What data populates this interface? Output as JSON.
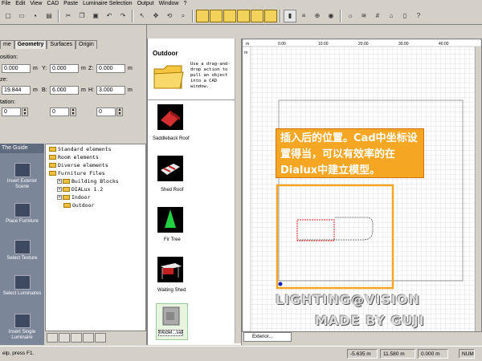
{
  "menu": [
    "File",
    "Edit",
    "View",
    "CAD",
    "Paste",
    "Luminaire Selection",
    "Output",
    "Window",
    "?"
  ],
  "left": {
    "tabs": [
      "me",
      "Geometry",
      "Surfaces",
      "Origin"
    ],
    "position_label": "osition:",
    "size_label": "ze:",
    "rotation_label": "tation:",
    "x_value": "0.000",
    "y_value": "0.000",
    "z_value": "0.000",
    "l_value": "19.844",
    "b_value": "6.000",
    "h_value": "3.000",
    "rot1": "0",
    "rot2": "0",
    "rot3": "0",
    "unit": "m",
    "x_label": "X:",
    "y_label": "Y:",
    "z_label": "Z:",
    "l_label": "L:",
    "b_label": "B:",
    "h_label": "H:"
  },
  "guide": {
    "title": "The Guide",
    "items": [
      "Insert Exterior Scene",
      "Place Furniture",
      "Select Texture",
      "Select Luminaires",
      "Insert Single Luminaire"
    ]
  },
  "tree": {
    "items": [
      "Standard elements",
      "Room elements",
      "Diverse elements",
      "Furniture Files",
      "Building Blocks",
      "DIALux 1.2",
      "Indoor",
      "Outdoor"
    ]
  },
  "catalog": {
    "title": "Outdoor",
    "hint": "Use a drag-and-drop action to pull an object into a CAD window.",
    "items": [
      "Saddleback Roof",
      "Shed Roof",
      "Fir Tree",
      "Waiting Shed",
      "Model...sat"
    ]
  },
  "canvas": {
    "ruler_top": [
      "m",
      "0.00",
      "10.00",
      "20.00",
      "30.00",
      "40.00"
    ],
    "ruler_left": [
      "m",
      "0.00"
    ]
  },
  "annotation": "插入后的位置。Cad中坐标设置得当，可以有效率的在Dialux中建立模型。",
  "watermark1": "LIGHTING@VISION",
  "watermark2": "MADE BY GUJI",
  "doc_tab": "Exterior...",
  "status": {
    "help": "elp, press F1.",
    "x": "-5.635 m",
    "y": "11.580 m",
    "z": "0.000 m",
    "num": "NUM"
  },
  "colors": {
    "accent": "#f5a623",
    "guide_bg": "#7b8699"
  }
}
